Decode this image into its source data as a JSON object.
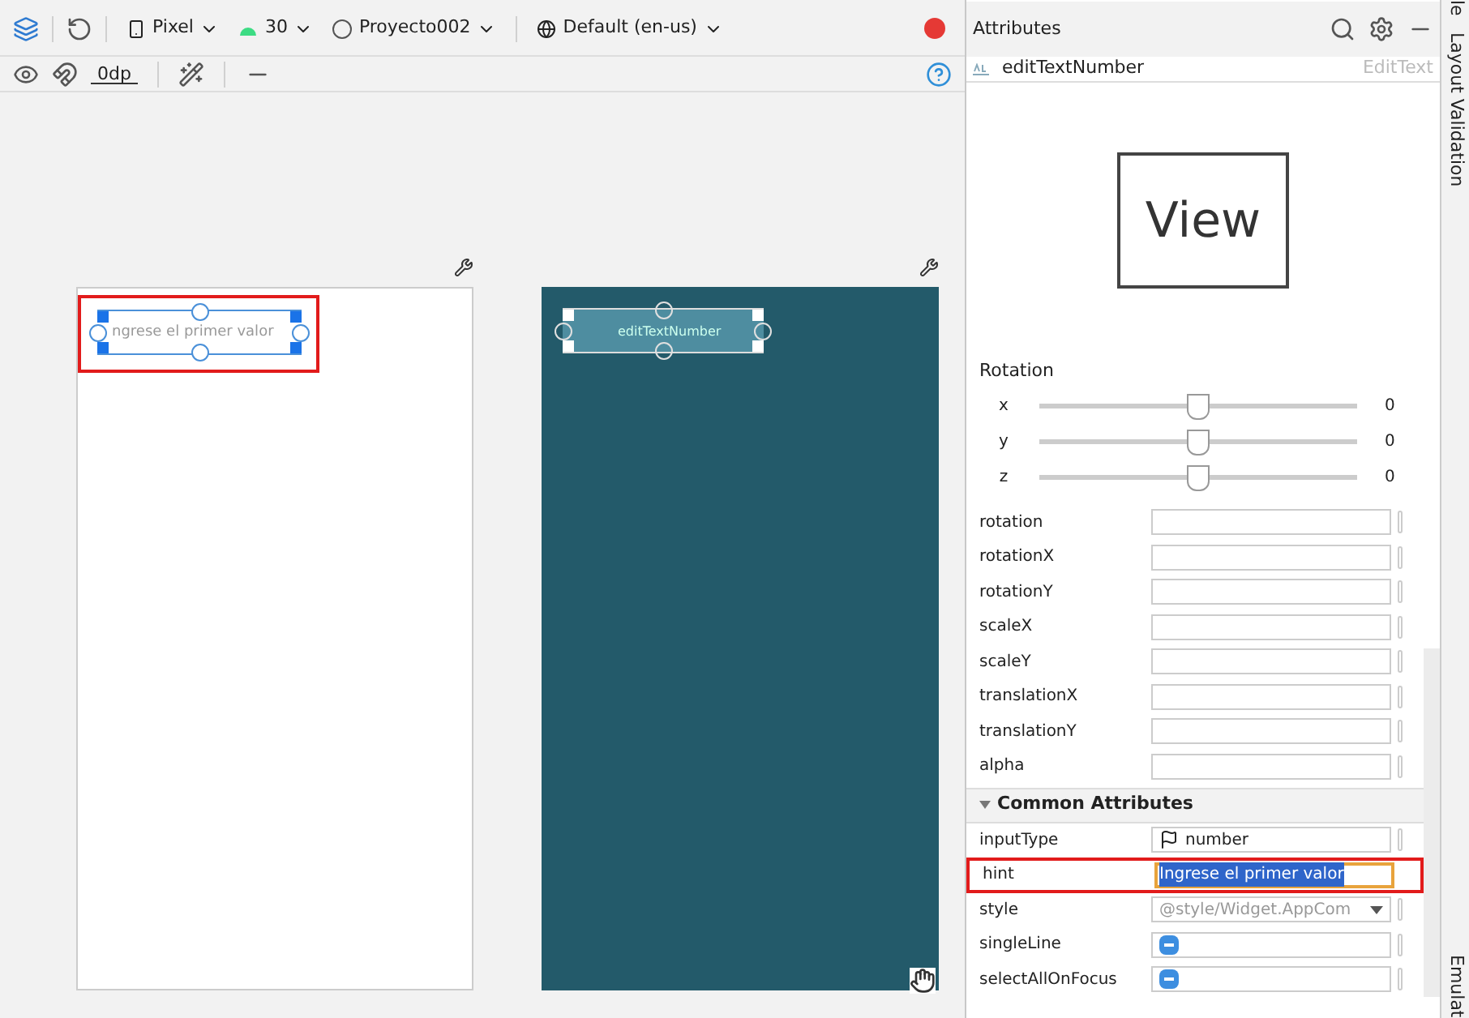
{
  "toolbar": {
    "device": "Pixel",
    "api": "30",
    "theme": "Proyecto002",
    "locale": "Default (en-us)",
    "margin": "0dp"
  },
  "design": {
    "hint_text": "ngrese el primer valor",
    "blueprint_label": "editTextNumber",
    "selected": true
  },
  "attributes": {
    "title": "Attributes",
    "component": {
      "id": "editTextNumber",
      "type": "EditText"
    },
    "preview_label": "View",
    "rotation": {
      "title": "Rotation",
      "axes": [
        {
          "label": "x",
          "level": 0.5,
          "reading": "0"
        },
        {
          "label": "y",
          "level": 0.5,
          "reading": "0"
        },
        {
          "label": "z",
          "level": 0.5,
          "reading": "0"
        }
      ]
    },
    "transforms": [
      "rotation",
      "rotationX",
      "rotationY",
      "scaleX",
      "scaleY",
      "translationX",
      "translationY",
      "alpha"
    ],
    "common": {
      "title": "Common Attributes",
      "expanded": true,
      "rows": [
        {
          "name": "inputType",
          "kind": "flag",
          "value": "number"
        },
        {
          "name": "hint",
          "kind": "text",
          "value": "Ingrese el primer valor",
          "selected": true
        },
        {
          "name": "style",
          "kind": "dropdown",
          "value": "@style/Widget.AppCom"
        },
        {
          "name": "singleLine",
          "kind": "toggle",
          "indeterminate": true
        },
        {
          "name": "selectAllOnFocus",
          "kind": "toggle",
          "indeterminate": true
        }
      ]
    }
  },
  "side_tabs": [
    "le",
    "Layout Validation",
    "Emulat"
  ]
}
